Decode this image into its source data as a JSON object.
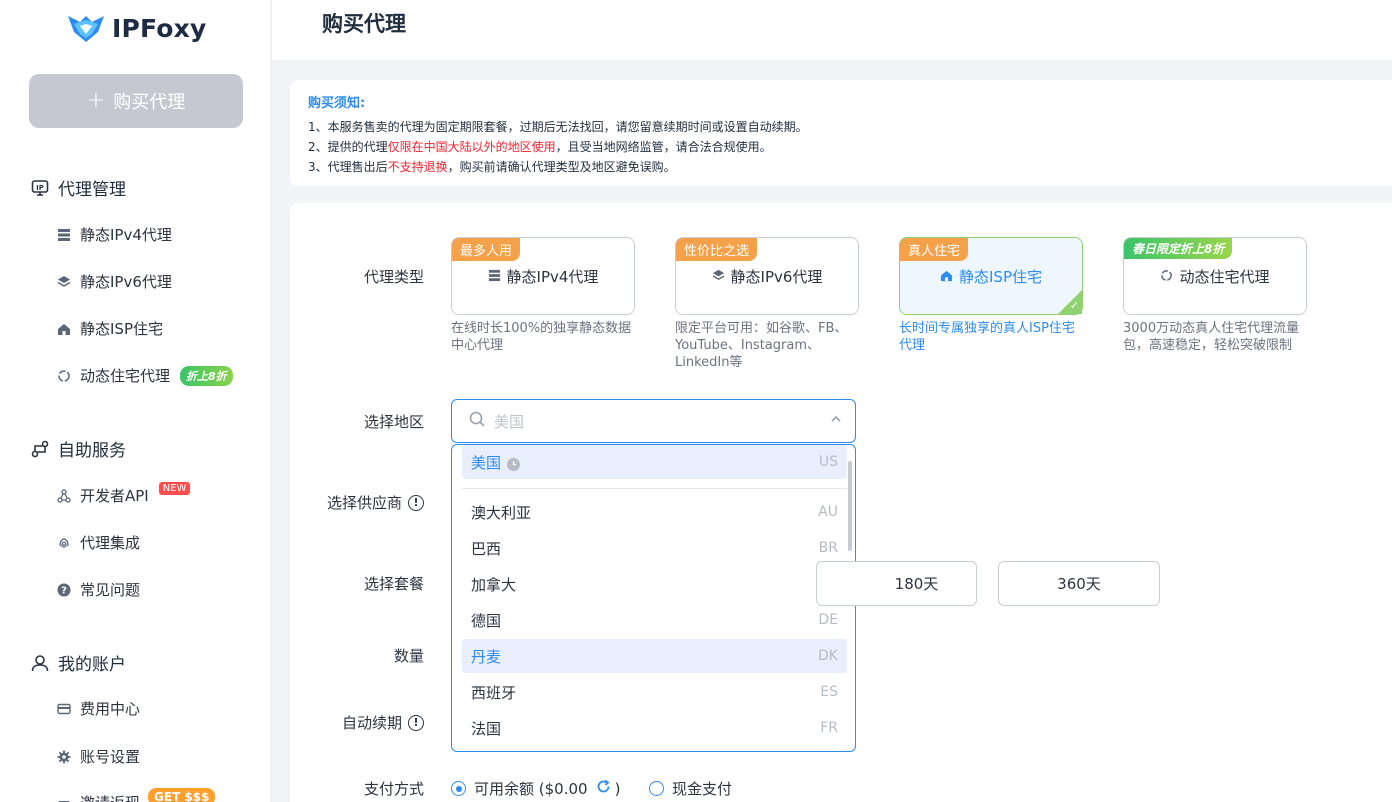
{
  "brand": {
    "name": "IPFoxy"
  },
  "sidebar": {
    "buy_button": "购买代理",
    "groups": [
      {
        "label": "代理管理",
        "items": [
          {
            "label": "静态IPv4代理"
          },
          {
            "label": "静态IPv6代理"
          },
          {
            "label": "静态ISP住宅"
          },
          {
            "label": "动态住宅代理",
            "badge": "折上8折"
          }
        ]
      },
      {
        "label": "自助服务",
        "items": [
          {
            "label": "开发者API",
            "badge": "NEW"
          },
          {
            "label": "代理集成"
          },
          {
            "label": "常见问题"
          }
        ]
      },
      {
        "label": "我的账户",
        "items": [
          {
            "label": "费用中心"
          },
          {
            "label": "账号设置"
          },
          {
            "label": "邀请返现",
            "badge": "GET $$$"
          }
        ]
      }
    ]
  },
  "header": {
    "title": "购买代理"
  },
  "notice": {
    "title": "购买须知:",
    "line1": "1、本服务售卖的代理为固定期限套餐，过期后无法找回，请您留意续期时间或设置自动续期。",
    "line2_a": "2、提供的代理",
    "line2_red": "仅限在中国大陆以外的地区使用",
    "line2_b": "，且受当地网络监管，请合法合规使用。",
    "line3_a": "3、代理售出后",
    "line3_red": "不支持退换",
    "line3_b": "，购买前请确认代理类型及地区避免误购。"
  },
  "form": {
    "labels": {
      "type": "代理类型",
      "region": "选择地区",
      "provider": "选择供应商",
      "plan": "选择套餐",
      "quantity": "数量",
      "auto_renew": "自动续期",
      "payment": "支付方式"
    },
    "types": [
      {
        "tag": "最多人用",
        "name": "静态IPv4代理",
        "desc": "在线时长100%的独享静态数据中心代理",
        "icon": "server-icon"
      },
      {
        "tag": "性价比之选",
        "name": "静态IPv6代理",
        "desc": "限定平台可用：如谷歌、FB、YouTube、Instagram、LinkedIn等",
        "icon": "layers-icon"
      },
      {
        "tag": "真人住宅",
        "name": "静态ISP住宅",
        "desc": "长时间专属独享的真人ISP住宅代理",
        "icon": "home-icon",
        "active": true
      },
      {
        "tag": "春日限定折上8折",
        "name": "动态住宅代理",
        "desc": "3000万动态真人住宅代理流量包，高速稳定，轻松突破限制",
        "icon": "refresh-icon"
      }
    ],
    "region_placeholder": "美国",
    "regions": [
      {
        "name": "美国",
        "code": "US"
      },
      {
        "name": "澳大利亚",
        "code": "AU"
      },
      {
        "name": "巴西",
        "code": "BR"
      },
      {
        "name": "加拿大",
        "code": "CA"
      },
      {
        "name": "德国",
        "code": "DE"
      },
      {
        "name": "丹麦",
        "code": "DK"
      },
      {
        "name": "西班牙",
        "code": "ES"
      },
      {
        "name": "法国",
        "code": "FR"
      }
    ],
    "plans": [
      "180天",
      "360天"
    ],
    "payment": {
      "balance_label": "可用余额 ($0.00",
      "balance_close": ")",
      "cash_label": "现金支付"
    }
  },
  "colors": {
    "accent": "#2d8cf0",
    "active_border": "#8fd16e",
    "tag_orange": "#f5a14a"
  }
}
